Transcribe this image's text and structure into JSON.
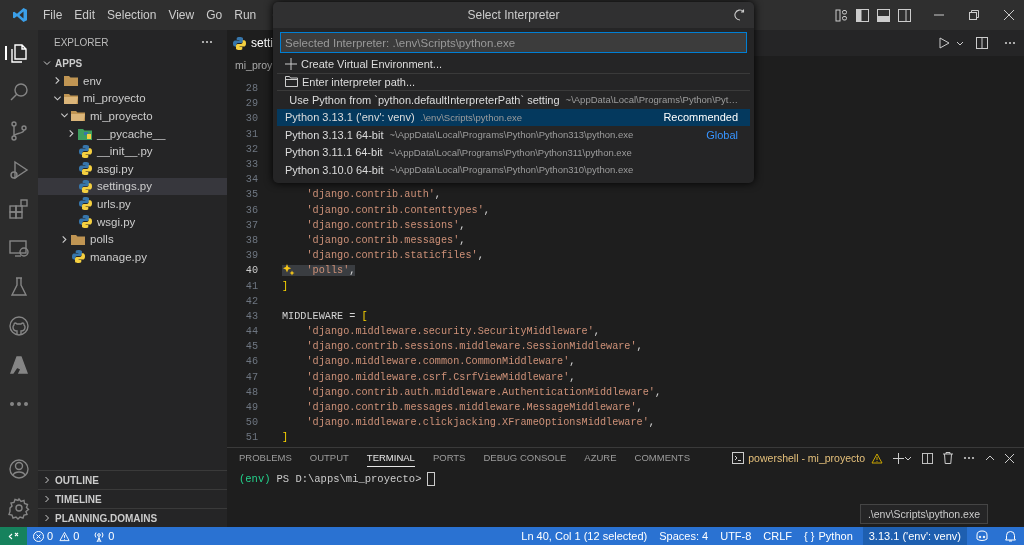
{
  "menu": [
    "File",
    "Edit",
    "Selection",
    "View",
    "Go",
    "Run"
  ],
  "activity": [
    {
      "kind": "files",
      "selected": true
    },
    {
      "kind": "search",
      "selected": false
    },
    {
      "kind": "source-control",
      "selected": false
    },
    {
      "kind": "run-debug",
      "selected": false
    },
    {
      "kind": "extensions",
      "selected": false
    },
    {
      "kind": "remote",
      "selected": false
    },
    {
      "kind": "testing",
      "selected": false
    },
    {
      "kind": "github",
      "selected": false
    },
    {
      "kind": "azure",
      "selected": false
    },
    {
      "kind": "more",
      "selected": false
    }
  ],
  "activity_bottom": [
    {
      "kind": "account"
    },
    {
      "kind": "settings"
    }
  ],
  "sidebar": {
    "title": "EXPLORER",
    "workspace": {
      "label": "APPS",
      "expanded": true,
      "children": [
        {
          "label": "env",
          "kind": "folder",
          "expanded": false,
          "selected": false
        },
        {
          "label": "mi_proyecto",
          "kind": "folder",
          "expanded": true,
          "selected": false,
          "children": [
            {
              "label": "mi_proyecto",
              "kind": "folder",
              "expanded": true,
              "selected": false,
              "children": [
                {
                  "label": "__pycache__",
                  "kind": "cache-folder",
                  "expanded": false,
                  "selected": false
                },
                {
                  "label": "__init__.py",
                  "kind": "python-file",
                  "selected": false
                },
                {
                  "label": "asgi.py",
                  "kind": "python-file",
                  "selected": false
                },
                {
                  "label": "settings.py",
                  "kind": "python-file",
                  "selected": true
                },
                {
                  "label": "urls.py",
                  "kind": "python-file",
                  "selected": false
                },
                {
                  "label": "wsgi.py",
                  "kind": "python-file",
                  "selected": false
                }
              ]
            },
            {
              "label": "polls",
              "kind": "folder",
              "expanded": false,
              "selected": false
            },
            {
              "label": "manage.py",
              "kind": "python-file",
              "selected": false
            }
          ]
        }
      ]
    },
    "sections": [
      {
        "label": "OUTLINE",
        "expanded": false
      },
      {
        "label": "TIMELINE",
        "expanded": false
      },
      {
        "label": "PLANNING.DOMAINS",
        "expanded": false
      }
    ]
  },
  "editor": {
    "tab": "setti",
    "breadcrumb": "mi_proy",
    "lines": [
      {
        "number": "28",
        "selected": false
      },
      {
        "number": "29",
        "selected": false
      },
      {
        "number": "30",
        "selected": false
      },
      {
        "number": "31",
        "selected": false
      },
      {
        "number": "32",
        "selected": false
      },
      {
        "number": "33",
        "selected": false
      },
      {
        "number": "34",
        "selected": false
      },
      {
        "number": "35",
        "code": "    'django.contrib.auth',",
        "selected": false
      },
      {
        "number": "36",
        "code": "    'django.contrib.contenttypes',",
        "selected": false
      },
      {
        "number": "37",
        "code": "    'django.contrib.sessions',",
        "selected": false
      },
      {
        "number": "38",
        "code": "    'django.contrib.messages',",
        "selected": false
      },
      {
        "number": "39",
        "code": "    'django.contrib.staticfiles',",
        "selected": false
      },
      {
        "number": "40",
        "code": "    'polls',",
        "selected": true
      },
      {
        "number": "41",
        "code": "]",
        "selected": false
      },
      {
        "number": "42",
        "selected": false
      },
      {
        "number": "43",
        "code": "MIDDLEWARE = [",
        "selected": false
      },
      {
        "number": "44",
        "code": "    'django.middleware.security.SecurityMiddleware',",
        "selected": false
      },
      {
        "number": "45",
        "code": "    'django.contrib.sessions.middleware.SessionMiddleware',",
        "selected": false
      },
      {
        "number": "46",
        "code": "    'django.middleware.common.CommonMiddleware',",
        "selected": false
      },
      {
        "number": "47",
        "code": "    'django.middleware.csrf.CsrfViewMiddleware',",
        "selected": false
      },
      {
        "number": "48",
        "code": "    'django.contrib.auth.middleware.AuthenticationMiddleware',",
        "selected": false
      },
      {
        "number": "49",
        "code": "    'django.contrib.messages.middleware.MessageMiddleware',",
        "selected": false
      },
      {
        "number": "50",
        "code": "    'django.middleware.clickjacking.XFrameOptionsMiddleware',",
        "selected": false
      },
      {
        "number": "51",
        "code": "]",
        "selected": false
      }
    ]
  },
  "panel": {
    "tabs": [
      {
        "label": "PROBLEMS",
        "selected": false
      },
      {
        "label": "OUTPUT",
        "selected": false
      },
      {
        "label": "TERMINAL",
        "selected": true
      },
      {
        "label": "PORTS",
        "selected": false
      },
      {
        "label": "DEBUG CONSOLE",
        "selected": false
      },
      {
        "label": "AZURE",
        "selected": false
      },
      {
        "label": "COMMENTS",
        "selected": false
      }
    ],
    "terminal_name": "powershell - mi_proyecto",
    "prompt_env": "(env)",
    "prompt": "PS D:\\apps\\mi_proyecto>"
  },
  "quick_pick": {
    "title": "Select Interpreter",
    "placeholder": "Selected Interpreter: .\\env\\Scripts\\python.exe",
    "items": [
      {
        "kind": "create",
        "label": "Create Virtual Environment...",
        "selected": false
      },
      {
        "kind": "browse",
        "label": "Enter interpreter path...",
        "selected": false
      },
      {
        "kind": "setting",
        "label": "Use Python from `python.defaultInterpreterPath` setting",
        "description": "~\\AppData\\Local\\Programs\\Python\\Pyt…",
        "selected": false
      },
      {
        "kind": "interpreter",
        "label": "Python 3.13.1 ('env': venv)",
        "description": ".\\env\\Scripts\\python.exe",
        "badge": "Recommended",
        "selected": true
      },
      {
        "kind": "interpreter",
        "label": "Python 3.13.1 64-bit",
        "description": "~\\AppData\\Local\\Programs\\Python\\Python313\\python.exe",
        "badge": "Global",
        "selected": false
      },
      {
        "kind": "interpreter",
        "label": "Python 3.11.1 64-bit",
        "description": "~\\AppData\\Local\\Programs\\Python\\Python311\\python.exe",
        "selected": false
      },
      {
        "kind": "interpreter",
        "label": "Python 3.10.0 64-bit",
        "description": "~\\AppData\\Local\\Programs\\Python\\Python310\\python.exe",
        "selected": false
      }
    ]
  },
  "tooltip": ".\\env\\Scripts\\python.exe",
  "status_bar": {
    "errors": "0",
    "warnings": "0",
    "ports": "0",
    "right": [
      {
        "kind": "text",
        "label": "Ln 40, Col 1 (12 selected)"
      },
      {
        "kind": "text",
        "label": "Spaces: 4"
      },
      {
        "kind": "text",
        "label": "UTF-8"
      },
      {
        "kind": "text",
        "label": "CRLF"
      },
      {
        "kind": "language",
        "prefix": "{ }",
        "label": "Python"
      },
      {
        "kind": "interpreter",
        "label": "3.13.1 ('env': venv)"
      }
    ]
  }
}
